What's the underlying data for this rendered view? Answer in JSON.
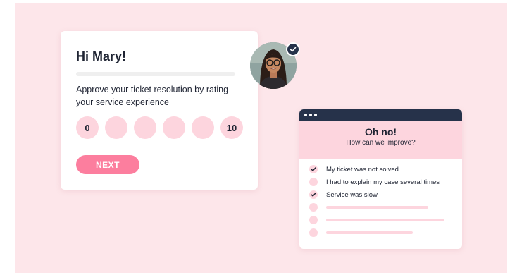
{
  "survey": {
    "greeting": "Hi Mary!",
    "progress": 0,
    "question": "Approve your ticket resolution by rating your service experience",
    "rating_options": [
      "0",
      "",
      "",
      "",
      "",
      "10"
    ],
    "next_label": "NEXT"
  },
  "avatar": {
    "icon": "avatar-photo",
    "badge_icon": "check-icon",
    "verified": true
  },
  "feedback": {
    "title": "Oh no!",
    "subtitle": "How can we improve?",
    "options": [
      {
        "label": "My ticket was not solved",
        "checked": true
      },
      {
        "label": "I had to explain my case several times",
        "checked": false
      },
      {
        "label": "Service was slow",
        "checked": true
      },
      {
        "label": "",
        "checked": false
      },
      {
        "label": "",
        "checked": false
      },
      {
        "label": "",
        "checked": false
      }
    ]
  },
  "colors": {
    "background": "#fde6ea",
    "accent": "#fc7e9e",
    "soft_pink": "#fdd5de",
    "navy": "#26324a"
  }
}
